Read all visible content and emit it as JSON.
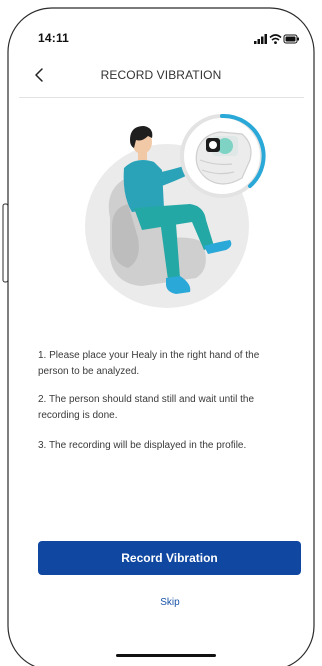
{
  "status_bar": {
    "time": "14:11",
    "icons": [
      "signal-icon",
      "wifi-icon",
      "battery-icon"
    ]
  },
  "nav": {
    "back_icon": "chevron-left-icon",
    "title": "RECORD VIBRATION"
  },
  "illustration": {
    "subject": "person-seated-holding-device-illustration",
    "accent_color": "#2aa8d8",
    "shirt_color": "#2aa3b8",
    "circle_color": "#ebebeb"
  },
  "instructions": [
    "1. Please place your Healy in the right hand of the person to be analyzed.",
    "2. The person should stand still and wait until the recording is done.",
    "3. The recording will be displayed in the profile."
  ],
  "actions": {
    "record_label": "Record Vibration",
    "skip_label": "Skip"
  },
  "colors": {
    "primary": "#0f47a1",
    "link": "#1a54a8",
    "text": "#3a3a3a"
  }
}
